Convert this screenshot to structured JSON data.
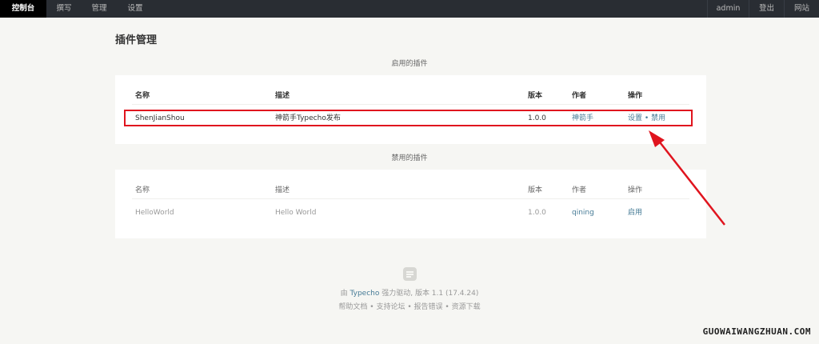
{
  "nav": {
    "left": [
      "控制台",
      "撰写",
      "管理",
      "设置"
    ],
    "right": [
      "admin",
      "登出",
      "网站"
    ]
  },
  "page_title": "插件管理",
  "enabled_section": {
    "title": "启用的插件",
    "headers": [
      "名称",
      "描述",
      "版本",
      "作者",
      "操作"
    ],
    "rows": [
      {
        "name": "ShenJianShou",
        "desc": "神箭手Typecho发布",
        "version": "1.0.0",
        "author": "神箭手",
        "action_settings": "设置",
        "action_sep": "•",
        "action_disable": "禁用"
      }
    ]
  },
  "disabled_section": {
    "title": "禁用的插件",
    "headers": [
      "名称",
      "描述",
      "版本",
      "作者",
      "操作"
    ],
    "rows": [
      {
        "name": "HelloWorld",
        "desc": "Hello World",
        "version": "1.0.0",
        "author": "qining",
        "action_enable": "启用"
      }
    ]
  },
  "footer": {
    "prefix": "由 ",
    "brand": "Typecho",
    "suffix": " 强力驱动, 版本 1.1 (17.4.24)",
    "links": [
      "帮助文档",
      "支持论坛",
      "报告错误",
      "资源下载"
    ],
    "separator": "•"
  },
  "watermark": "GUOWAIWANGZHUAN.COM",
  "colors": {
    "nav_bg": "#292d33",
    "link": "#467b96",
    "highlight": "#e0141e",
    "page_bg": "#f6f6f3"
  }
}
